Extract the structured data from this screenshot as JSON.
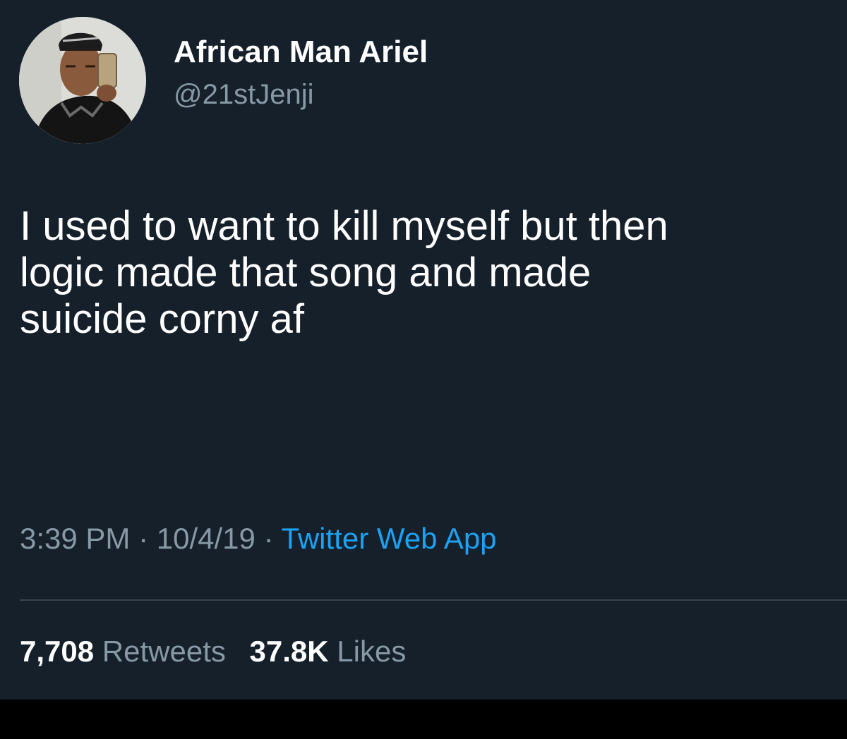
{
  "user": {
    "display_name": "African Man Ariel",
    "handle": "@21stJenji",
    "avatar_icon": "profile-photo-selfie"
  },
  "tweet": {
    "lines": [
      "I used to want to kill myself but then",
      "logic made that song and made",
      "suicide corny af"
    ]
  },
  "meta": {
    "time": "3:39 PM",
    "separator": "·",
    "date": "10/4/19",
    "source": "Twitter Web App"
  },
  "stats": {
    "retweets_count": "7,708",
    "retweets_label": "Retweets",
    "likes_count": "37.8K",
    "likes_label": "Likes"
  },
  "colors": {
    "background": "#15202b",
    "primary_text": "#ffffff",
    "secondary_text": "#8899a6",
    "link": "#1da1f2",
    "divider": "#38444d",
    "bottom_bar": "#000000"
  }
}
